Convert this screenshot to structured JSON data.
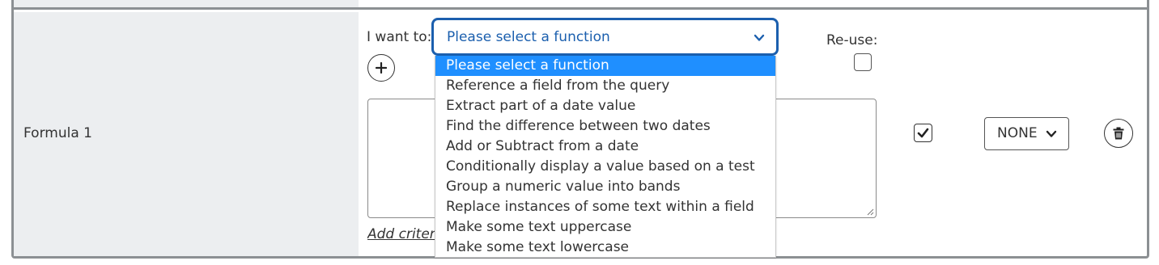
{
  "row": {
    "label": "Formula 1"
  },
  "function_picker": {
    "prompt_label": "I want to:",
    "selected": "Please select a function",
    "options": [
      "Please select a function",
      "Reference a field from the query",
      "Extract part of a date value",
      "Find the difference between two dates",
      "Add or Subtract from a date",
      "Conditionally display a value based on a test",
      "Group a numeric value into bands",
      "Replace instances of some text within a field",
      "Make some text uppercase",
      "Make some text lowercase"
    ]
  },
  "reuse": {
    "label": "Re-use:",
    "checked": false
  },
  "criteria": {
    "link_label": "Add criteria"
  },
  "visible": {
    "checked": true
  },
  "sort": {
    "selected": "NONE"
  },
  "colors": {
    "accent": "#1b5fae",
    "highlight": "#1f8fff",
    "label_cell_bg": "#eceef0",
    "frame_border": "#8c9093"
  },
  "icons": {
    "add": "plus-icon",
    "dropdown": "chevron-down-icon",
    "visible": "checkmark-icon",
    "delete": "trash-icon"
  }
}
